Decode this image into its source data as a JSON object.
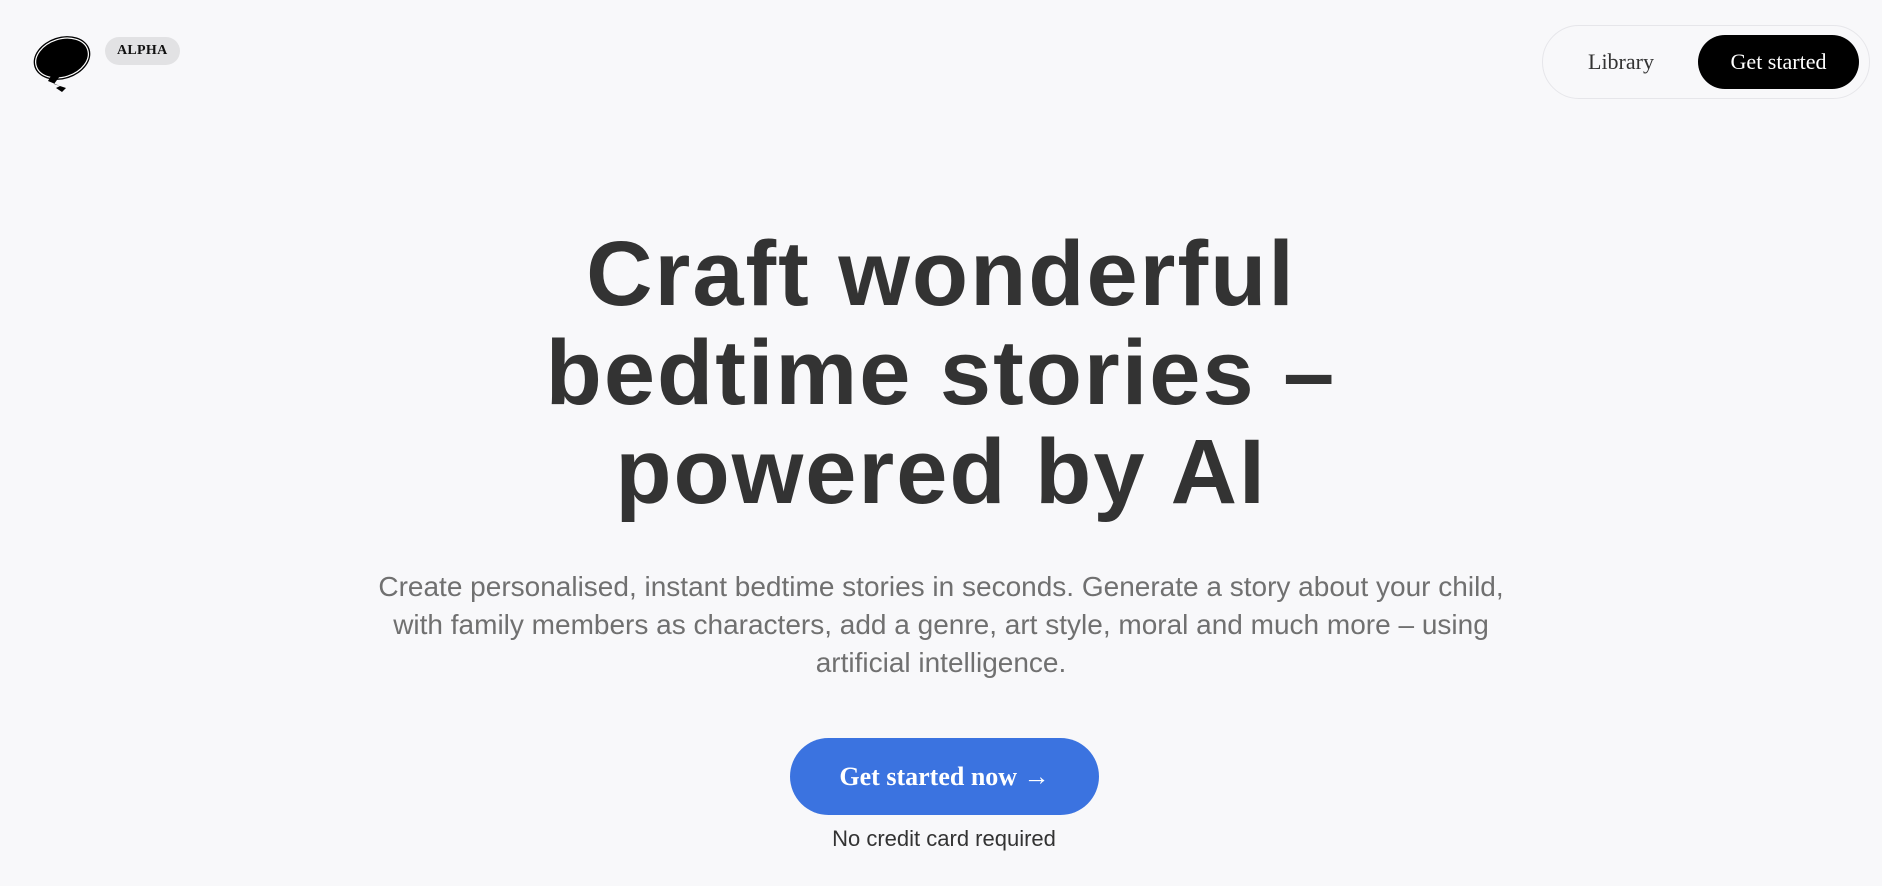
{
  "header": {
    "logo_icon": "speech-bubble-lightning-logo",
    "badge": "ALPHA",
    "nav": {
      "library_label": "Library",
      "get_started_label": "Get started"
    }
  },
  "hero": {
    "title_lines": [
      "Craft wonderful",
      "bedtime stories –",
      "powered by AI"
    ],
    "subtitle": "Create personalised, instant bedtime stories in seconds. Generate a story about your child, with family members as characters, add a genre, art style, moral and much more – using artificial intelligence.",
    "cta_label": "Get started now →",
    "cta_note": "No credit card required"
  },
  "colors": {
    "background": "#f8f8fa",
    "text": "#333333",
    "subtext": "#707070",
    "cta": "#3b73e0",
    "nav_button": "#000000",
    "badge": "#e2e2e4"
  }
}
